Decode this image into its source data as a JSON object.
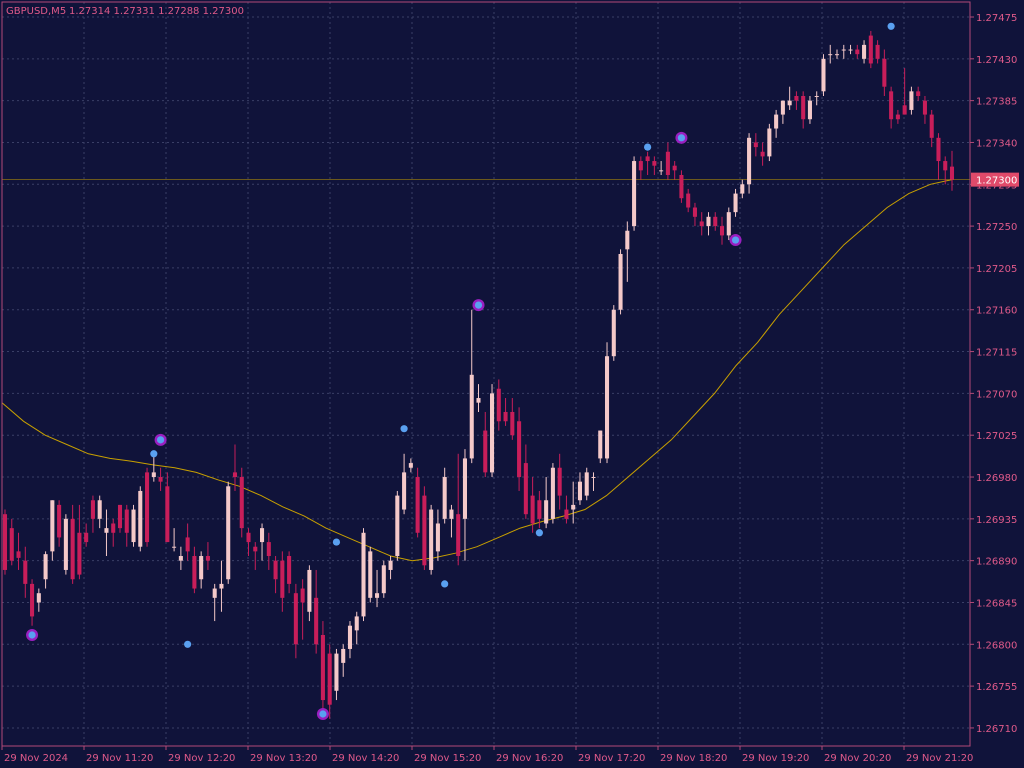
{
  "header": {
    "symbol_timeframe": "GBPUSD,M5",
    "ohlc": "1.27314 1.27331 1.27288 1.27300"
  },
  "current_price_label": "1.27300",
  "colors": {
    "background": "#10133a",
    "grid": "#3a3f66",
    "frame": "#b24a78",
    "axis_text": "#e05a8a",
    "bull_candle": "#f4c9c9",
    "bear_candle": "#c81e5a",
    "moving_average": "#c8a000",
    "marker_blue": "#5aa0f0",
    "marker_ring": "#9a1fc0",
    "price_line": "#c8a000",
    "price_label_bg": "#e04a6a",
    "price_label_text": "#ffffff"
  },
  "chart_data": {
    "type": "candlestick",
    "symbol": "GBPUSD",
    "timeframe": "M5",
    "y_tick_labels": [
      "1.27475",
      "1.27430",
      "1.27385",
      "1.27340",
      "1.27295",
      "1.27250",
      "1.27205",
      "1.27160",
      "1.27115",
      "1.27070",
      "1.27025",
      "1.26980",
      "1.26935",
      "1.26890",
      "1.26845",
      "1.26800",
      "1.26755",
      "1.26710"
    ],
    "x_tick_labels": [
      "29 Nov 2024",
      "29 Nov 11:20",
      "29 Nov 12:20",
      "29 Nov 13:20",
      "29 Nov 14:20",
      "29 Nov 15:20",
      "29 Nov 16:20",
      "29 Nov 17:20",
      "29 Nov 18:20",
      "29 Nov 19:20",
      "29 Nov 20:20",
      "29 Nov 21:20"
    ],
    "ylim": [
      1.267,
      1.2748
    ],
    "candles": [
      {
        "o": 1.2694,
        "h": 1.26945,
        "l": 1.26875,
        "c": 1.2688
      },
      {
        "o": 1.26925,
        "h": 1.26935,
        "l": 1.26885,
        "c": 1.2689
      },
      {
        "o": 1.269,
        "h": 1.2692,
        "l": 1.2688,
        "c": 1.26893
      },
      {
        "o": 1.2689,
        "h": 1.26905,
        "l": 1.2685,
        "c": 1.26865
      },
      {
        "o": 1.26865,
        "h": 1.2687,
        "l": 1.2682,
        "c": 1.2683
      },
      {
        "o": 1.26845,
        "h": 1.2686,
        "l": 1.26835,
        "c": 1.26855
      },
      {
        "o": 1.2687,
        "h": 1.269,
        "l": 1.2686,
        "c": 1.26897
      },
      {
        "o": 1.269,
        "h": 1.26955,
        "l": 1.2689,
        "c": 1.26955
      },
      {
        "o": 1.2695,
        "h": 1.26955,
        "l": 1.26905,
        "c": 1.26915
      },
      {
        "o": 1.2688,
        "h": 1.2694,
        "l": 1.26875,
        "c": 1.26935
      },
      {
        "o": 1.26935,
        "h": 1.2695,
        "l": 1.26865,
        "c": 1.2687
      },
      {
        "o": 1.2692,
        "h": 1.2695,
        "l": 1.2687,
        "c": 1.26875
      },
      {
        "o": 1.2692,
        "h": 1.2693,
        "l": 1.26905,
        "c": 1.2691
      },
      {
        "o": 1.26955,
        "h": 1.2696,
        "l": 1.2692,
        "c": 1.26935
      },
      {
        "o": 1.26935,
        "h": 1.2696,
        "l": 1.26925,
        "c": 1.26955
      },
      {
        "o": 1.2692,
        "h": 1.26945,
        "l": 1.26895,
        "c": 1.26925
      },
      {
        "o": 1.2693,
        "h": 1.26935,
        "l": 1.26905,
        "c": 1.2692
      },
      {
        "o": 1.2695,
        "h": 1.2695,
        "l": 1.2692,
        "c": 1.26925
      },
      {
        "o": 1.26945,
        "h": 1.2695,
        "l": 1.26905,
        "c": 1.2692
      },
      {
        "o": 1.2691,
        "h": 1.2695,
        "l": 1.26905,
        "c": 1.26945
      },
      {
        "o": 1.26905,
        "h": 1.2697,
        "l": 1.269,
        "c": 1.26965
      },
      {
        "o": 1.26985,
        "h": 1.2699,
        "l": 1.26905,
        "c": 1.2691
      },
      {
        "o": 1.2698,
        "h": 1.27005,
        "l": 1.26975,
        "c": 1.26985
      },
      {
        "o": 1.2698,
        "h": 1.2699,
        "l": 1.26965,
        "c": 1.26975
      },
      {
        "o": 1.2697,
        "h": 1.26985,
        "l": 1.2691,
        "c": 1.2691
      },
      {
        "o": 1.26905,
        "h": 1.26925,
        "l": 1.269,
        "c": 1.26905
      },
      {
        "o": 1.2689,
        "h": 1.26905,
        "l": 1.2688,
        "c": 1.26895
      },
      {
        "o": 1.26915,
        "h": 1.2693,
        "l": 1.2689,
        "c": 1.269
      },
      {
        "o": 1.26895,
        "h": 1.26905,
        "l": 1.26855,
        "c": 1.2686
      },
      {
        "o": 1.2687,
        "h": 1.269,
        "l": 1.2686,
        "c": 1.26895
      },
      {
        "o": 1.26895,
        "h": 1.2691,
        "l": 1.2688,
        "c": 1.2689
      },
      {
        "o": 1.2685,
        "h": 1.26865,
        "l": 1.26825,
        "c": 1.2686
      },
      {
        "o": 1.2686,
        "h": 1.2689,
        "l": 1.26835,
        "c": 1.26865
      },
      {
        "o": 1.2687,
        "h": 1.26975,
        "l": 1.26865,
        "c": 1.2697
      },
      {
        "o": 1.26985,
        "h": 1.27015,
        "l": 1.26965,
        "c": 1.2698
      },
      {
        "o": 1.2698,
        "h": 1.2699,
        "l": 1.26915,
        "c": 1.26925
      },
      {
        "o": 1.2692,
        "h": 1.26925,
        "l": 1.26895,
        "c": 1.2691
      },
      {
        "o": 1.26905,
        "h": 1.2691,
        "l": 1.2688,
        "c": 1.269
      },
      {
        "o": 1.2691,
        "h": 1.2693,
        "l": 1.2689,
        "c": 1.26925
      },
      {
        "o": 1.2691,
        "h": 1.2692,
        "l": 1.2688,
        "c": 1.26895
      },
      {
        "o": 1.2689,
        "h": 1.26895,
        "l": 1.26855,
        "c": 1.2687
      },
      {
        "o": 1.2689,
        "h": 1.269,
        "l": 1.26835,
        "c": 1.2685
      },
      {
        "o": 1.26895,
        "h": 1.269,
        "l": 1.26855,
        "c": 1.26865
      },
      {
        "o": 1.26855,
        "h": 1.26865,
        "l": 1.26785,
        "c": 1.268
      },
      {
        "o": 1.2686,
        "h": 1.2687,
        "l": 1.26805,
        "c": 1.26845
      },
      {
        "o": 1.26835,
        "h": 1.26885,
        "l": 1.26825,
        "c": 1.2688
      },
      {
        "o": 1.2685,
        "h": 1.2688,
        "l": 1.2679,
        "c": 1.268
      },
      {
        "o": 1.2681,
        "h": 1.26825,
        "l": 1.2672,
        "c": 1.2674
      },
      {
        "o": 1.2679,
        "h": 1.268,
        "l": 1.2672,
        "c": 1.26735
      },
      {
        "o": 1.2675,
        "h": 1.26795,
        "l": 1.2674,
        "c": 1.2679
      },
      {
        "o": 1.2678,
        "h": 1.268,
        "l": 1.26765,
        "c": 1.26795
      },
      {
        "o": 1.26795,
        "h": 1.26825,
        "l": 1.26785,
        "c": 1.2682
      },
      {
        "o": 1.26815,
        "h": 1.26835,
        "l": 1.268,
        "c": 1.2683
      },
      {
        "o": 1.2683,
        "h": 1.26925,
        "l": 1.26825,
        "c": 1.2692
      },
      {
        "o": 1.2685,
        "h": 1.26905,
        "l": 1.26845,
        "c": 1.269
      },
      {
        "o": 1.2685,
        "h": 1.2688,
        "l": 1.2684,
        "c": 1.26855
      },
      {
        "o": 1.26855,
        "h": 1.2689,
        "l": 1.2685,
        "c": 1.26885
      },
      {
        "o": 1.2688,
        "h": 1.26895,
        "l": 1.2687,
        "c": 1.2689
      },
      {
        "o": 1.26895,
        "h": 1.26965,
        "l": 1.2689,
        "c": 1.2696
      },
      {
        "o": 1.26945,
        "h": 1.27005,
        "l": 1.2694,
        "c": 1.26985
      },
      {
        "o": 1.2699,
        "h": 1.27,
        "l": 1.26985,
        "c": 1.26995
      },
      {
        "o": 1.2698,
        "h": 1.2699,
        "l": 1.26915,
        "c": 1.2692
      },
      {
        "o": 1.2696,
        "h": 1.2697,
        "l": 1.2688,
        "c": 1.26885
      },
      {
        "o": 1.2688,
        "h": 1.2695,
        "l": 1.26875,
        "c": 1.26945
      },
      {
        "o": 1.269,
        "h": 1.26945,
        "l": 1.2689,
        "c": 1.2693
      },
      {
        "o": 1.26935,
        "h": 1.2699,
        "l": 1.2693,
        "c": 1.2698
      },
      {
        "o": 1.26935,
        "h": 1.2695,
        "l": 1.26915,
        "c": 1.26945
      },
      {
        "o": 1.2694,
        "h": 1.27005,
        "l": 1.26885,
        "c": 1.26895
      },
      {
        "o": 1.26935,
        "h": 1.2701,
        "l": 1.2689,
        "c": 1.27
      },
      {
        "o": 1.27,
        "h": 1.2716,
        "l": 1.26995,
        "c": 1.2709
      },
      {
        "o": 1.2706,
        "h": 1.2708,
        "l": 1.2705,
        "c": 1.27065
      },
      {
        "o": 1.2703,
        "h": 1.2705,
        "l": 1.2698,
        "c": 1.26985
      },
      {
        "o": 1.26985,
        "h": 1.2708,
        "l": 1.2698,
        "c": 1.2707
      },
      {
        "o": 1.27075,
        "h": 1.27085,
        "l": 1.2703,
        "c": 1.2704
      },
      {
        "o": 1.2705,
        "h": 1.27065,
        "l": 1.27035,
        "c": 1.2704
      },
      {
        "o": 1.2705,
        "h": 1.27065,
        "l": 1.2702,
        "c": 1.27025
      },
      {
        "o": 1.2704,
        "h": 1.27055,
        "l": 1.26965,
        "c": 1.2698
      },
      {
        "o": 1.26995,
        "h": 1.27015,
        "l": 1.26935,
        "c": 1.2694
      },
      {
        "o": 1.2696,
        "h": 1.2698,
        "l": 1.2692,
        "c": 1.2693
      },
      {
        "o": 1.26955,
        "h": 1.26965,
        "l": 1.26925,
        "c": 1.26935
      },
      {
        "o": 1.2693,
        "h": 1.2698,
        "l": 1.26925,
        "c": 1.26955
      },
      {
        "o": 1.26935,
        "h": 1.26995,
        "l": 1.2693,
        "c": 1.2699
      },
      {
        "o": 1.2699,
        "h": 1.27005,
        "l": 1.26945,
        "c": 1.2696
      },
      {
        "o": 1.26945,
        "h": 1.2696,
        "l": 1.2693,
        "c": 1.26935
      },
      {
        "o": 1.26945,
        "h": 1.26975,
        "l": 1.2693,
        "c": 1.2695
      },
      {
        "o": 1.26955,
        "h": 1.26985,
        "l": 1.2695,
        "c": 1.26975
      },
      {
        "o": 1.2696,
        "h": 1.2699,
        "l": 1.26955,
        "c": 1.26985
      },
      {
        "o": 1.2698,
        "h": 1.26985,
        "l": 1.26965,
        "c": 1.2698
      },
      {
        "o": 1.27,
        "h": 1.2703,
        "l": 1.26995,
        "c": 1.2703
      },
      {
        "o": 1.27,
        "h": 1.27125,
        "l": 1.26995,
        "c": 1.2711
      },
      {
        "o": 1.2711,
        "h": 1.27165,
        "l": 1.27105,
        "c": 1.2716
      },
      {
        "o": 1.2716,
        "h": 1.27225,
        "l": 1.27155,
        "c": 1.2722
      },
      {
        "o": 1.27225,
        "h": 1.27255,
        "l": 1.2719,
        "c": 1.27245
      },
      {
        "o": 1.2725,
        "h": 1.27325,
        "l": 1.27245,
        "c": 1.2732
      },
      {
        "o": 1.2732,
        "h": 1.27325,
        "l": 1.273,
        "c": 1.2731
      },
      {
        "o": 1.27325,
        "h": 1.2733,
        "l": 1.27305,
        "c": 1.2732
      },
      {
        "o": 1.2732,
        "h": 1.27325,
        "l": 1.27305,
        "c": 1.27315
      },
      {
        "o": 1.2731,
        "h": 1.2732,
        "l": 1.27305,
        "c": 1.2731
      },
      {
        "o": 1.2733,
        "h": 1.2734,
        "l": 1.273,
        "c": 1.27305
      },
      {
        "o": 1.27315,
        "h": 1.2732,
        "l": 1.273,
        "c": 1.2731
      },
      {
        "o": 1.27305,
        "h": 1.2731,
        "l": 1.27275,
        "c": 1.2728
      },
      {
        "o": 1.27285,
        "h": 1.2729,
        "l": 1.27265,
        "c": 1.2727
      },
      {
        "o": 1.2727,
        "h": 1.27275,
        "l": 1.2725,
        "c": 1.2726
      },
      {
        "o": 1.27255,
        "h": 1.27265,
        "l": 1.2724,
        "c": 1.2725
      },
      {
        "o": 1.2725,
        "h": 1.27265,
        "l": 1.2724,
        "c": 1.2726
      },
      {
        "o": 1.2726,
        "h": 1.27265,
        "l": 1.27245,
        "c": 1.2725
      },
      {
        "o": 1.2725,
        "h": 1.2726,
        "l": 1.2723,
        "c": 1.2724
      },
      {
        "o": 1.2724,
        "h": 1.2727,
        "l": 1.27235,
        "c": 1.27265
      },
      {
        "o": 1.27265,
        "h": 1.2729,
        "l": 1.2726,
        "c": 1.27285
      },
      {
        "o": 1.27285,
        "h": 1.273,
        "l": 1.2728,
        "c": 1.27295
      },
      {
        "o": 1.27295,
        "h": 1.2735,
        "l": 1.27285,
        "c": 1.27345
      },
      {
        "o": 1.2734,
        "h": 1.2735,
        "l": 1.27325,
        "c": 1.27335
      },
      {
        "o": 1.2733,
        "h": 1.2734,
        "l": 1.27315,
        "c": 1.27325
      },
      {
        "o": 1.27325,
        "h": 1.2736,
        "l": 1.2732,
        "c": 1.27355
      },
      {
        "o": 1.27355,
        "h": 1.27375,
        "l": 1.27345,
        "c": 1.2737
      },
      {
        "o": 1.2737,
        "h": 1.27385,
        "l": 1.2736,
        "c": 1.27385
      },
      {
        "o": 1.2738,
        "h": 1.274,
        "l": 1.27375,
        "c": 1.27385
      },
      {
        "o": 1.2739,
        "h": 1.27395,
        "l": 1.27375,
        "c": 1.27385
      },
      {
        "o": 1.2739,
        "h": 1.27395,
        "l": 1.27355,
        "c": 1.27365
      },
      {
        "o": 1.27365,
        "h": 1.2739,
        "l": 1.2736,
        "c": 1.27385
      },
      {
        "o": 1.2739,
        "h": 1.27395,
        "l": 1.2738,
        "c": 1.2739
      },
      {
        "o": 1.27395,
        "h": 1.27435,
        "l": 1.2739,
        "c": 1.2743
      },
      {
        "o": 1.27435,
        "h": 1.27445,
        "l": 1.27425,
        "c": 1.27435
      },
      {
        "o": 1.27435,
        "h": 1.2744,
        "l": 1.2743,
        "c": 1.27435
      },
      {
        "o": 1.2744,
        "h": 1.27445,
        "l": 1.2743,
        "c": 1.2744
      },
      {
        "o": 1.2744,
        "h": 1.27445,
        "l": 1.27435,
        "c": 1.2744
      },
      {
        "o": 1.2744,
        "h": 1.27445,
        "l": 1.2743,
        "c": 1.27435
      },
      {
        "o": 1.2743,
        "h": 1.2745,
        "l": 1.27425,
        "c": 1.27445
      },
      {
        "o": 1.27455,
        "h": 1.2746,
        "l": 1.2742,
        "c": 1.27425
      },
      {
        "o": 1.27445,
        "h": 1.2745,
        "l": 1.27425,
        "c": 1.2743
      },
      {
        "o": 1.2743,
        "h": 1.2744,
        "l": 1.2739,
        "c": 1.274
      },
      {
        "o": 1.27395,
        "h": 1.274,
        "l": 1.27355,
        "c": 1.27365
      },
      {
        "o": 1.2737,
        "h": 1.27375,
        "l": 1.2736,
        "c": 1.27365
      },
      {
        "o": 1.2738,
        "h": 1.2742,
        "l": 1.2737,
        "c": 1.2737
      },
      {
        "o": 1.27375,
        "h": 1.274,
        "l": 1.2737,
        "c": 1.27395
      },
      {
        "o": 1.27395,
        "h": 1.274,
        "l": 1.27385,
        "c": 1.2739
      },
      {
        "o": 1.27385,
        "h": 1.2739,
        "l": 1.2736,
        "c": 1.2737
      },
      {
        "o": 1.2737,
        "h": 1.27375,
        "l": 1.27335,
        "c": 1.27345
      },
      {
        "o": 1.27345,
        "h": 1.2735,
        "l": 1.273,
        "c": 1.2732
      },
      {
        "o": 1.2732,
        "h": 1.27325,
        "l": 1.27295,
        "c": 1.2731
      },
      {
        "o": 1.27314,
        "h": 1.27331,
        "l": 1.27288,
        "c": 1.273
      }
    ],
    "moving_average": [
      1.2706,
      1.2704,
      1.27025,
      1.27015,
      1.27005,
      1.27,
      1.26997,
      1.26993,
      1.2699,
      1.26985,
      1.26977,
      1.2697,
      1.2696,
      1.26948,
      1.26938,
      1.26925,
      1.26915,
      1.26905,
      1.26895,
      1.2689,
      1.26893,
      1.26898,
      1.26905,
      1.26915,
      1.26925,
      1.26932,
      1.26938,
      1.26945,
      1.2696,
      1.2698,
      1.27,
      1.2702,
      1.27045,
      1.2707,
      1.271,
      1.27125,
      1.27155,
      1.2718,
      1.27205,
      1.2723,
      1.2725,
      1.2727,
      1.27285,
      1.27295,
      1.273
    ],
    "markers": [
      {
        "index": 4,
        "price": 1.2681,
        "ring": true
      },
      {
        "index": 22,
        "price": 1.27005,
        "ring": false
      },
      {
        "index": 23,
        "price": 1.2702,
        "ring": true
      },
      {
        "index": 27,
        "price": 1.268,
        "ring": false
      },
      {
        "index": 47,
        "price": 1.26725,
        "ring": true
      },
      {
        "index": 49,
        "price": 1.2691,
        "ring": false
      },
      {
        "index": 59,
        "price": 1.27032,
        "ring": false
      },
      {
        "index": 65,
        "price": 1.26865,
        "ring": false
      },
      {
        "index": 70,
        "price": 1.27165,
        "ring": true
      },
      {
        "index": 79,
        "price": 1.2692,
        "ring": false
      },
      {
        "index": 95,
        "price": 1.27335,
        "ring": false
      },
      {
        "index": 100,
        "price": 1.27345,
        "ring": true
      },
      {
        "index": 108,
        "price": 1.27235,
        "ring": true
      },
      {
        "index": 131,
        "price": 1.27465,
        "ring": false
      }
    ]
  }
}
